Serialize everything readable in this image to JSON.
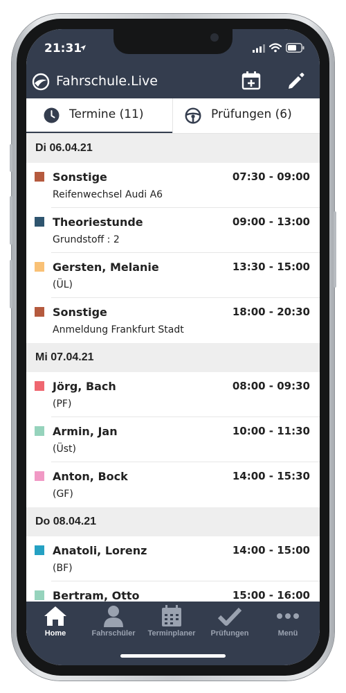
{
  "status_bar": {
    "time": "21:31"
  },
  "app_bar": {
    "title": "Fahrschule.Live"
  },
  "tabs": [
    {
      "label": "Termine (11)",
      "icon": "clock-icon",
      "active": true
    },
    {
      "label": "Prüfungen (6)",
      "icon": "steering-wheel-icon",
      "active": false
    }
  ],
  "days": [
    {
      "date": "Di 06.04.21",
      "items": [
        {
          "name": "Sonstige",
          "sub": "Reifenwechsel Audi A6",
          "time": "07:30 - 09:00",
          "color": "#b55a3e"
        },
        {
          "name": "Theoriestunde",
          "sub": "Grundstoff : 2",
          "time": "09:00 - 13:00",
          "color": "#2f556f"
        },
        {
          "name": "Gersten, Melanie",
          "sub": "(ÜL)",
          "time": "13:30 - 15:00",
          "color": "#f9c176"
        },
        {
          "name": "Sonstige",
          "sub": "Anmeldung Frankfurt Stadt",
          "time": "18:00 - 20:30",
          "color": "#b55a3e"
        }
      ]
    },
    {
      "date": "Mi 07.04.21",
      "items": [
        {
          "name": "Jörg, Bach",
          "sub": "(PF)",
          "time": "08:00 - 09:30",
          "color": "#ef6770"
        },
        {
          "name": "Armin, Jan",
          "sub": "(Üst)",
          "time": "10:00 - 11:30",
          "color": "#96d3bc"
        },
        {
          "name": "Anton, Bock",
          "sub": "(GF)",
          "time": "14:00 - 15:30",
          "color": "#f199c5"
        }
      ]
    },
    {
      "date": "Do 08.04.21",
      "items": [
        {
          "name": "Anatoli, Lorenz",
          "sub": "(BF)",
          "time": "14:00 - 15:00",
          "color": "#25a1c3"
        },
        {
          "name": "Bertram, Otto",
          "sub": "",
          "time": "15:00 - 16:00",
          "color": "#96d3bc"
        }
      ]
    }
  ],
  "bottom_nav": [
    {
      "label": "Home",
      "icon": "home-icon",
      "active": true
    },
    {
      "label": "Fahrschüler",
      "icon": "person-icon",
      "active": false
    },
    {
      "label": "Terminplaner",
      "icon": "calendar-icon",
      "active": false
    },
    {
      "label": "Prüfungen",
      "icon": "checkmark-icon",
      "active": false
    },
    {
      "label": "Menü",
      "icon": "more-dots-icon",
      "active": false
    }
  ]
}
